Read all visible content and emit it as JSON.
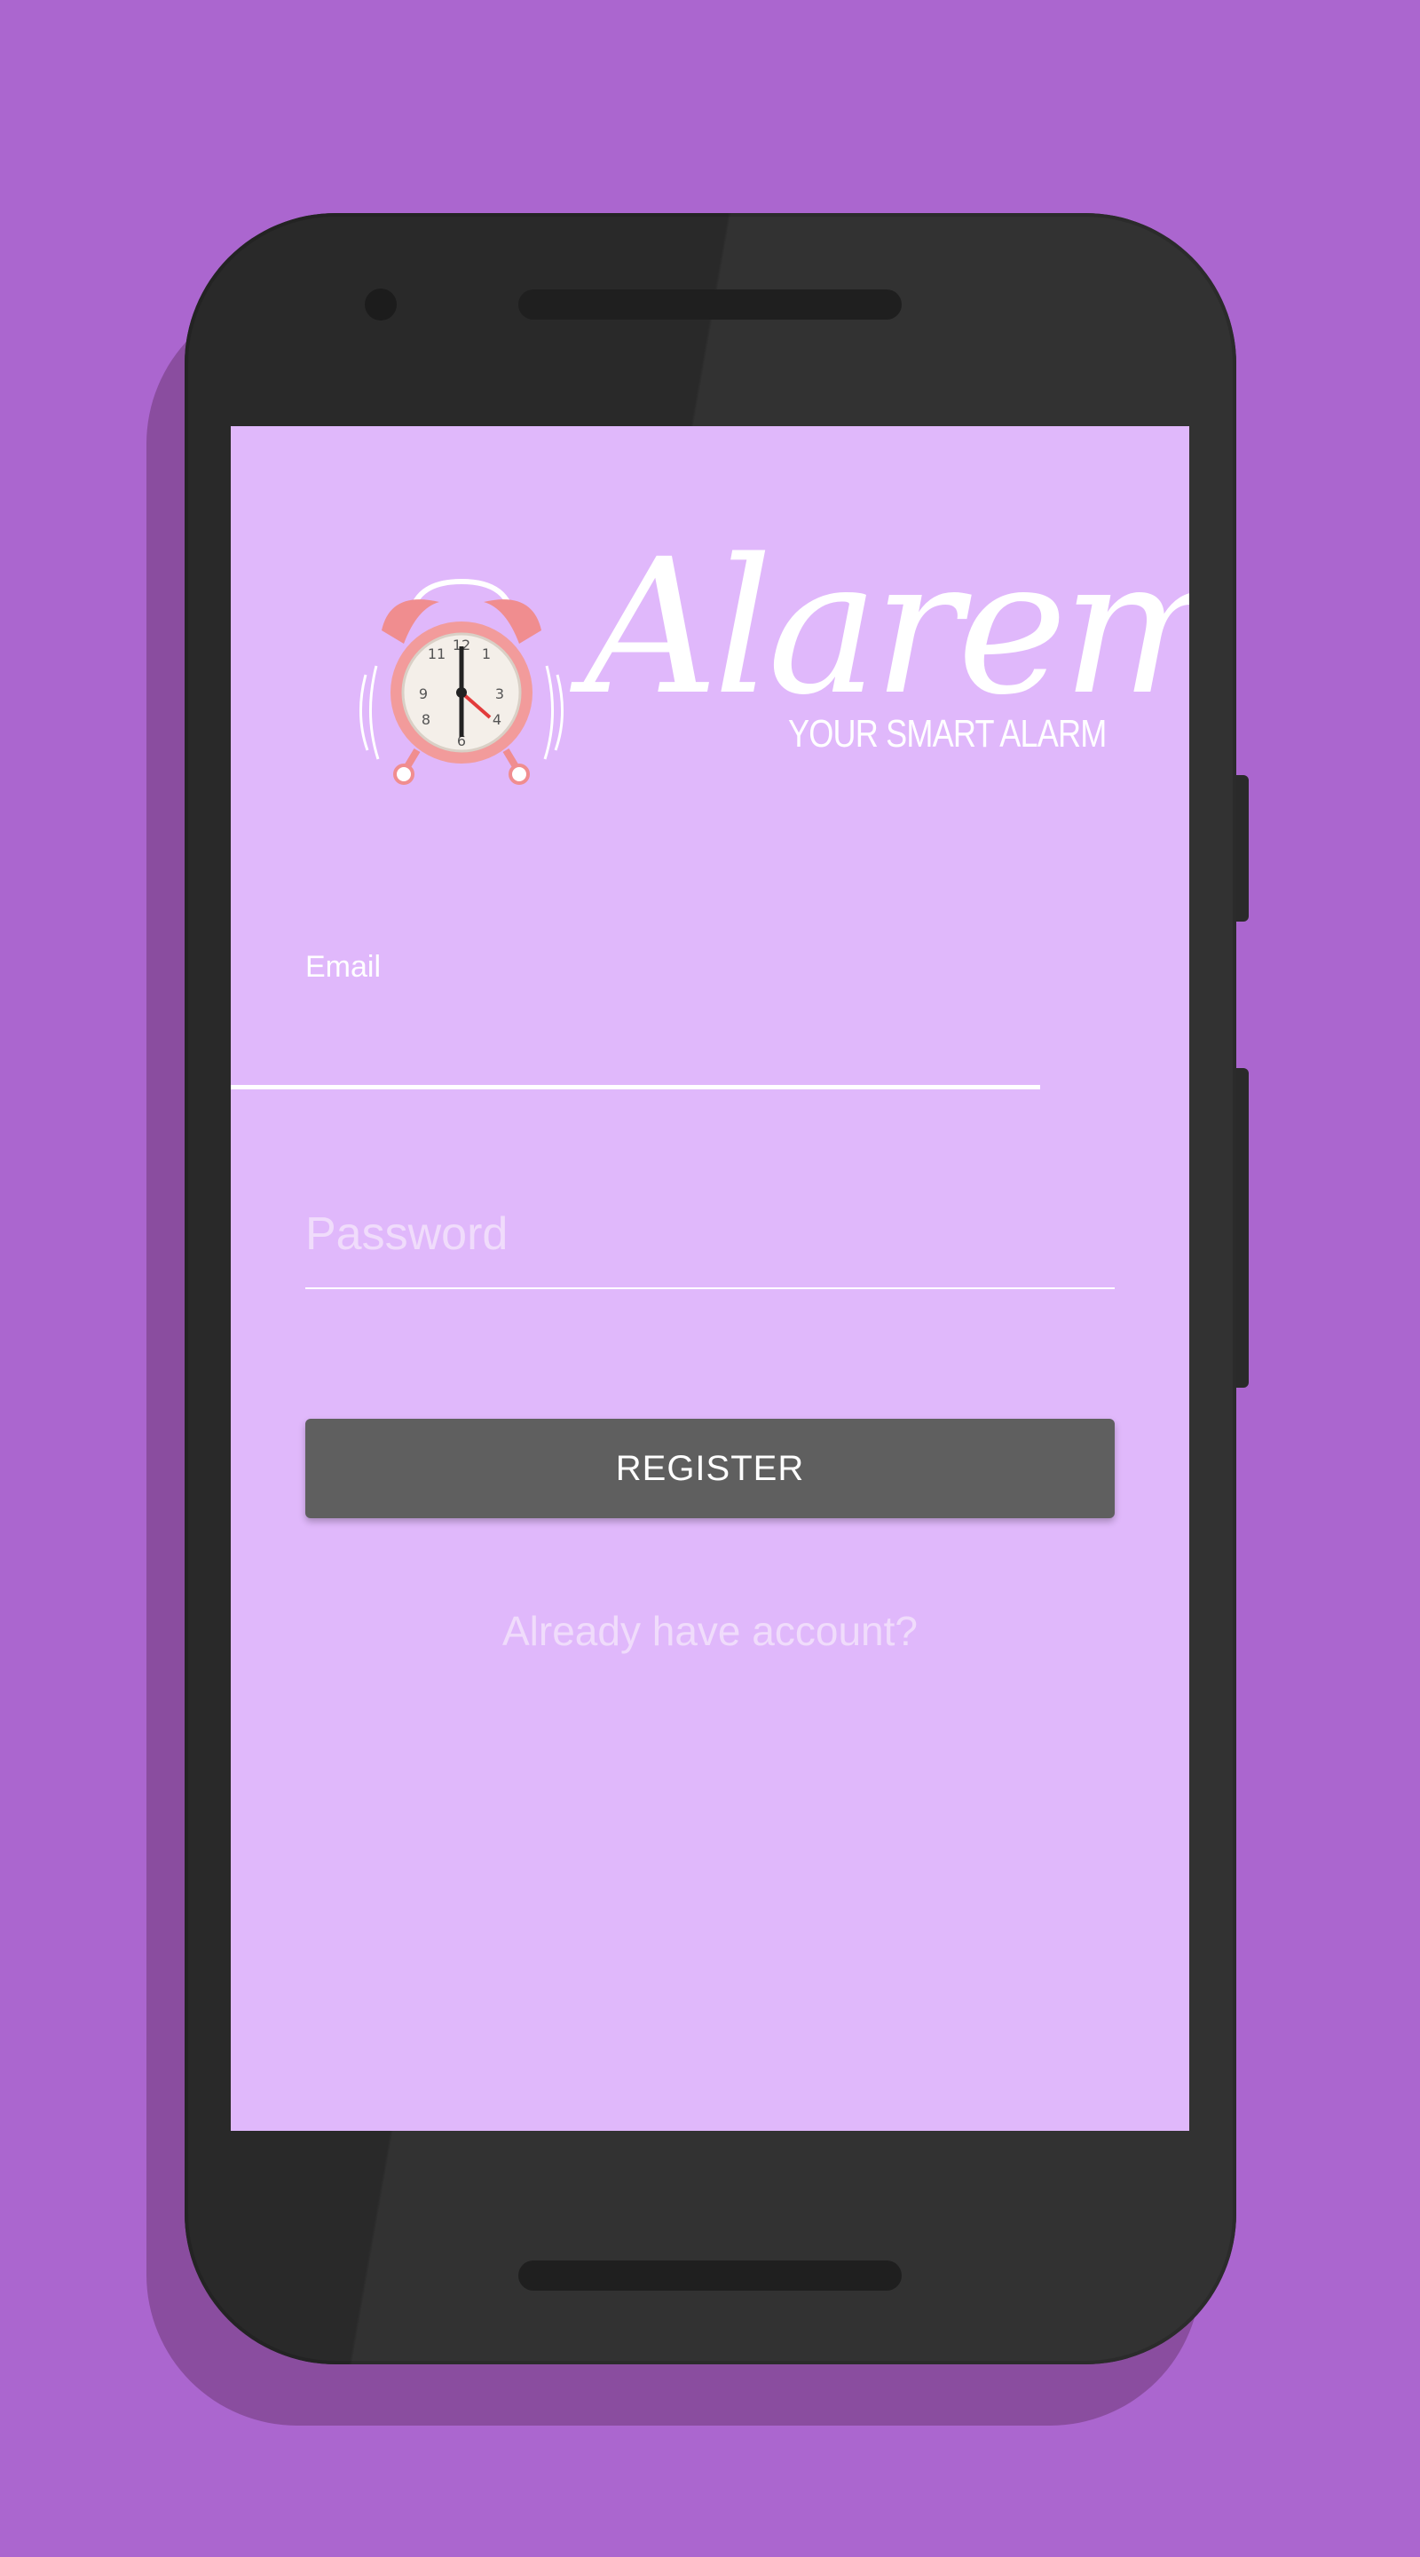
{
  "app": {
    "brand_name": "Alarem",
    "tagline": "YOUR SMART ALARM"
  },
  "form": {
    "email_label": "Email",
    "email_value": "",
    "password_placeholder": "Password",
    "password_value": "",
    "register_label": "REGISTER",
    "login_link": "Already have account?"
  },
  "colors": {
    "background": "#ab66cf",
    "screen": "#e0b8fb",
    "button": "#5f5f5f",
    "phone_body": "#323232"
  },
  "icons": {
    "logo": "alarm-clock-icon"
  }
}
